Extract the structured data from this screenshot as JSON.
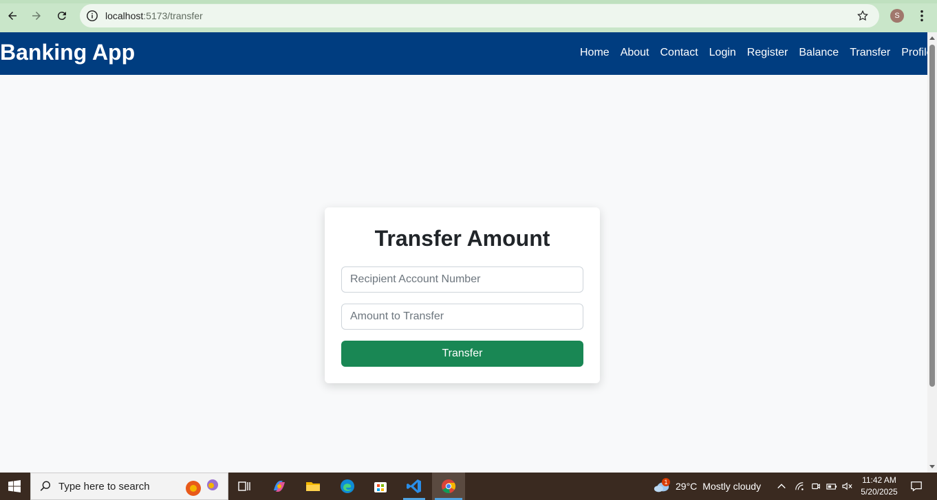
{
  "browser": {
    "url_host": "localhost",
    "url_path": ":5173/transfer",
    "profile_initial": "S"
  },
  "navbar": {
    "brand": "Banking App",
    "links": [
      "Home",
      "About",
      "Contact",
      "Login",
      "Register",
      "Balance",
      "Transfer",
      "Profile"
    ]
  },
  "form": {
    "title": "Transfer Amount",
    "recipient_placeholder": "Recipient Account Number",
    "amount_placeholder": "Amount to Transfer",
    "submit_label": "Transfer"
  },
  "taskbar": {
    "search_placeholder": "Type here to search",
    "weather_temp": "29°C",
    "weather_desc": "Mostly cloudy",
    "weather_badge": "1",
    "time": "11:42 AM",
    "date": "5/20/2025"
  },
  "colors": {
    "navbar": "#003d80",
    "submit": "#198754",
    "chrome": "#c9e6c9"
  },
  "icons": [
    "back-arrow-icon",
    "forward-arrow-icon",
    "reload-icon",
    "site-info-icon",
    "bookmark-star-icon",
    "kebab-menu-icon",
    "windows-start-icon",
    "search-icon",
    "task-view-icon",
    "copilot-icon",
    "file-explorer-icon",
    "edge-icon",
    "store-icon",
    "vscode-icon",
    "chrome-icon",
    "cloud-icon",
    "chevron-up-icon",
    "wifi-icon",
    "battery-icon",
    "volume-muted-icon",
    "notification-icon"
  ]
}
